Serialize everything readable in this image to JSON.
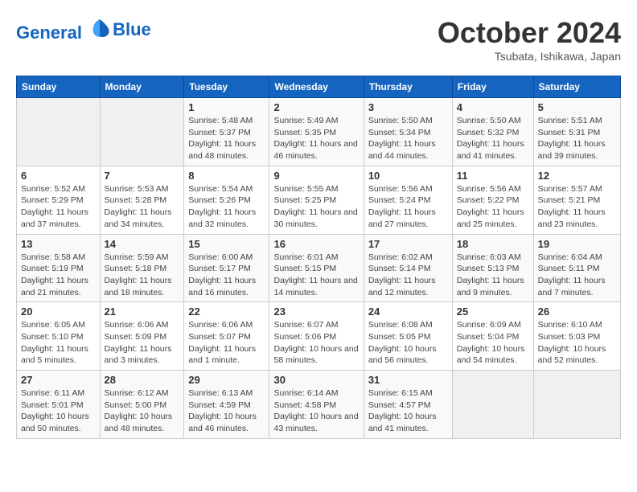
{
  "header": {
    "logo_line1": "General",
    "logo_line2": "Blue",
    "month": "October 2024",
    "location": "Tsubata, Ishikawa, Japan"
  },
  "weekdays": [
    "Sunday",
    "Monday",
    "Tuesday",
    "Wednesday",
    "Thursday",
    "Friday",
    "Saturday"
  ],
  "weeks": [
    [
      {
        "day": "",
        "info": ""
      },
      {
        "day": "",
        "info": ""
      },
      {
        "day": "1",
        "info": "Sunrise: 5:48 AM\nSunset: 5:37 PM\nDaylight: 11 hours and 48 minutes."
      },
      {
        "day": "2",
        "info": "Sunrise: 5:49 AM\nSunset: 5:35 PM\nDaylight: 11 hours and 46 minutes."
      },
      {
        "day": "3",
        "info": "Sunrise: 5:50 AM\nSunset: 5:34 PM\nDaylight: 11 hours and 44 minutes."
      },
      {
        "day": "4",
        "info": "Sunrise: 5:50 AM\nSunset: 5:32 PM\nDaylight: 11 hours and 41 minutes."
      },
      {
        "day": "5",
        "info": "Sunrise: 5:51 AM\nSunset: 5:31 PM\nDaylight: 11 hours and 39 minutes."
      }
    ],
    [
      {
        "day": "6",
        "info": "Sunrise: 5:52 AM\nSunset: 5:29 PM\nDaylight: 11 hours and 37 minutes."
      },
      {
        "day": "7",
        "info": "Sunrise: 5:53 AM\nSunset: 5:28 PM\nDaylight: 11 hours and 34 minutes."
      },
      {
        "day": "8",
        "info": "Sunrise: 5:54 AM\nSunset: 5:26 PM\nDaylight: 11 hours and 32 minutes."
      },
      {
        "day": "9",
        "info": "Sunrise: 5:55 AM\nSunset: 5:25 PM\nDaylight: 11 hours and 30 minutes."
      },
      {
        "day": "10",
        "info": "Sunrise: 5:56 AM\nSunset: 5:24 PM\nDaylight: 11 hours and 27 minutes."
      },
      {
        "day": "11",
        "info": "Sunrise: 5:56 AM\nSunset: 5:22 PM\nDaylight: 11 hours and 25 minutes."
      },
      {
        "day": "12",
        "info": "Sunrise: 5:57 AM\nSunset: 5:21 PM\nDaylight: 11 hours and 23 minutes."
      }
    ],
    [
      {
        "day": "13",
        "info": "Sunrise: 5:58 AM\nSunset: 5:19 PM\nDaylight: 11 hours and 21 minutes."
      },
      {
        "day": "14",
        "info": "Sunrise: 5:59 AM\nSunset: 5:18 PM\nDaylight: 11 hours and 18 minutes."
      },
      {
        "day": "15",
        "info": "Sunrise: 6:00 AM\nSunset: 5:17 PM\nDaylight: 11 hours and 16 minutes."
      },
      {
        "day": "16",
        "info": "Sunrise: 6:01 AM\nSunset: 5:15 PM\nDaylight: 11 hours and 14 minutes."
      },
      {
        "day": "17",
        "info": "Sunrise: 6:02 AM\nSunset: 5:14 PM\nDaylight: 11 hours and 12 minutes."
      },
      {
        "day": "18",
        "info": "Sunrise: 6:03 AM\nSunset: 5:13 PM\nDaylight: 11 hours and 9 minutes."
      },
      {
        "day": "19",
        "info": "Sunrise: 6:04 AM\nSunset: 5:11 PM\nDaylight: 11 hours and 7 minutes."
      }
    ],
    [
      {
        "day": "20",
        "info": "Sunrise: 6:05 AM\nSunset: 5:10 PM\nDaylight: 11 hours and 5 minutes."
      },
      {
        "day": "21",
        "info": "Sunrise: 6:06 AM\nSunset: 5:09 PM\nDaylight: 11 hours and 3 minutes."
      },
      {
        "day": "22",
        "info": "Sunrise: 6:06 AM\nSunset: 5:07 PM\nDaylight: 11 hours and 1 minute."
      },
      {
        "day": "23",
        "info": "Sunrise: 6:07 AM\nSunset: 5:06 PM\nDaylight: 10 hours and 58 minutes."
      },
      {
        "day": "24",
        "info": "Sunrise: 6:08 AM\nSunset: 5:05 PM\nDaylight: 10 hours and 56 minutes."
      },
      {
        "day": "25",
        "info": "Sunrise: 6:09 AM\nSunset: 5:04 PM\nDaylight: 10 hours and 54 minutes."
      },
      {
        "day": "26",
        "info": "Sunrise: 6:10 AM\nSunset: 5:03 PM\nDaylight: 10 hours and 52 minutes."
      }
    ],
    [
      {
        "day": "27",
        "info": "Sunrise: 6:11 AM\nSunset: 5:01 PM\nDaylight: 10 hours and 50 minutes."
      },
      {
        "day": "28",
        "info": "Sunrise: 6:12 AM\nSunset: 5:00 PM\nDaylight: 10 hours and 48 minutes."
      },
      {
        "day": "29",
        "info": "Sunrise: 6:13 AM\nSunset: 4:59 PM\nDaylight: 10 hours and 46 minutes."
      },
      {
        "day": "30",
        "info": "Sunrise: 6:14 AM\nSunset: 4:58 PM\nDaylight: 10 hours and 43 minutes."
      },
      {
        "day": "31",
        "info": "Sunrise: 6:15 AM\nSunset: 4:57 PM\nDaylight: 10 hours and 41 minutes."
      },
      {
        "day": "",
        "info": ""
      },
      {
        "day": "",
        "info": ""
      }
    ]
  ]
}
